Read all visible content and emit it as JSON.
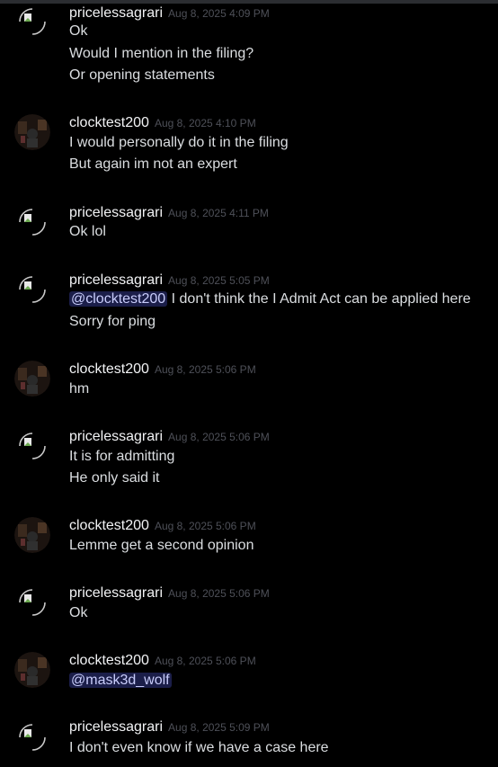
{
  "colors": {
    "background": "#000000",
    "username": "#f2f3f5",
    "timestamp": "#4e5058",
    "text": "#dbdee1",
    "mention_bg": "#3b3f86",
    "mention_text": "#c9cdfb"
  },
  "messages": [
    {
      "author": "pricelessagrari",
      "time": "Aug 8, 2025 4:09 PM",
      "avatar": "broken-image-icon",
      "lines": [
        "Ok",
        "Would I mention in the filing?",
        "Or opening statements"
      ]
    },
    {
      "author": "clocktest200",
      "time": "Aug 8, 2025 4:10 PM",
      "avatar": "photo-avatar",
      "lines": [
        "I would personally do it in the filing",
        "But again im not an expert"
      ]
    },
    {
      "author": "pricelessagrari",
      "time": "Aug 8, 2025 4:11 PM",
      "avatar": "broken-image-icon",
      "lines": [
        "Ok lol"
      ]
    },
    {
      "author": "pricelessagrari",
      "time": "Aug 8, 2025 5:05 PM",
      "avatar": "broken-image-icon",
      "mention": "@clocktest200",
      "lines": [
        " I don't think the I Admit Act can be applied here",
        "Sorry for ping"
      ]
    },
    {
      "author": "clocktest200",
      "time": "Aug 8, 2025 5:06 PM",
      "avatar": "photo-avatar",
      "lines": [
        "hm"
      ]
    },
    {
      "author": "pricelessagrari",
      "time": "Aug 8, 2025 5:06 PM",
      "avatar": "broken-image-icon",
      "lines": [
        "It is for admitting",
        "He only said it"
      ]
    },
    {
      "author": "clocktest200",
      "time": "Aug 8, 2025 5:06 PM",
      "avatar": "photo-avatar",
      "lines": [
        "Lemme get a second opinion"
      ]
    },
    {
      "author": "pricelessagrari",
      "time": "Aug 8, 2025 5:06 PM",
      "avatar": "broken-image-icon",
      "lines": [
        "Ok"
      ]
    },
    {
      "author": "clocktest200",
      "time": "Aug 8, 2025 5:06 PM",
      "avatar": "photo-avatar",
      "mention": "@mask3d_wolf",
      "lines": []
    },
    {
      "author": "pricelessagrari",
      "time": "Aug 8, 2025 5:09 PM",
      "avatar": "broken-image-icon",
      "lines": [
        "I don't even know if we have a case here"
      ]
    }
  ]
}
